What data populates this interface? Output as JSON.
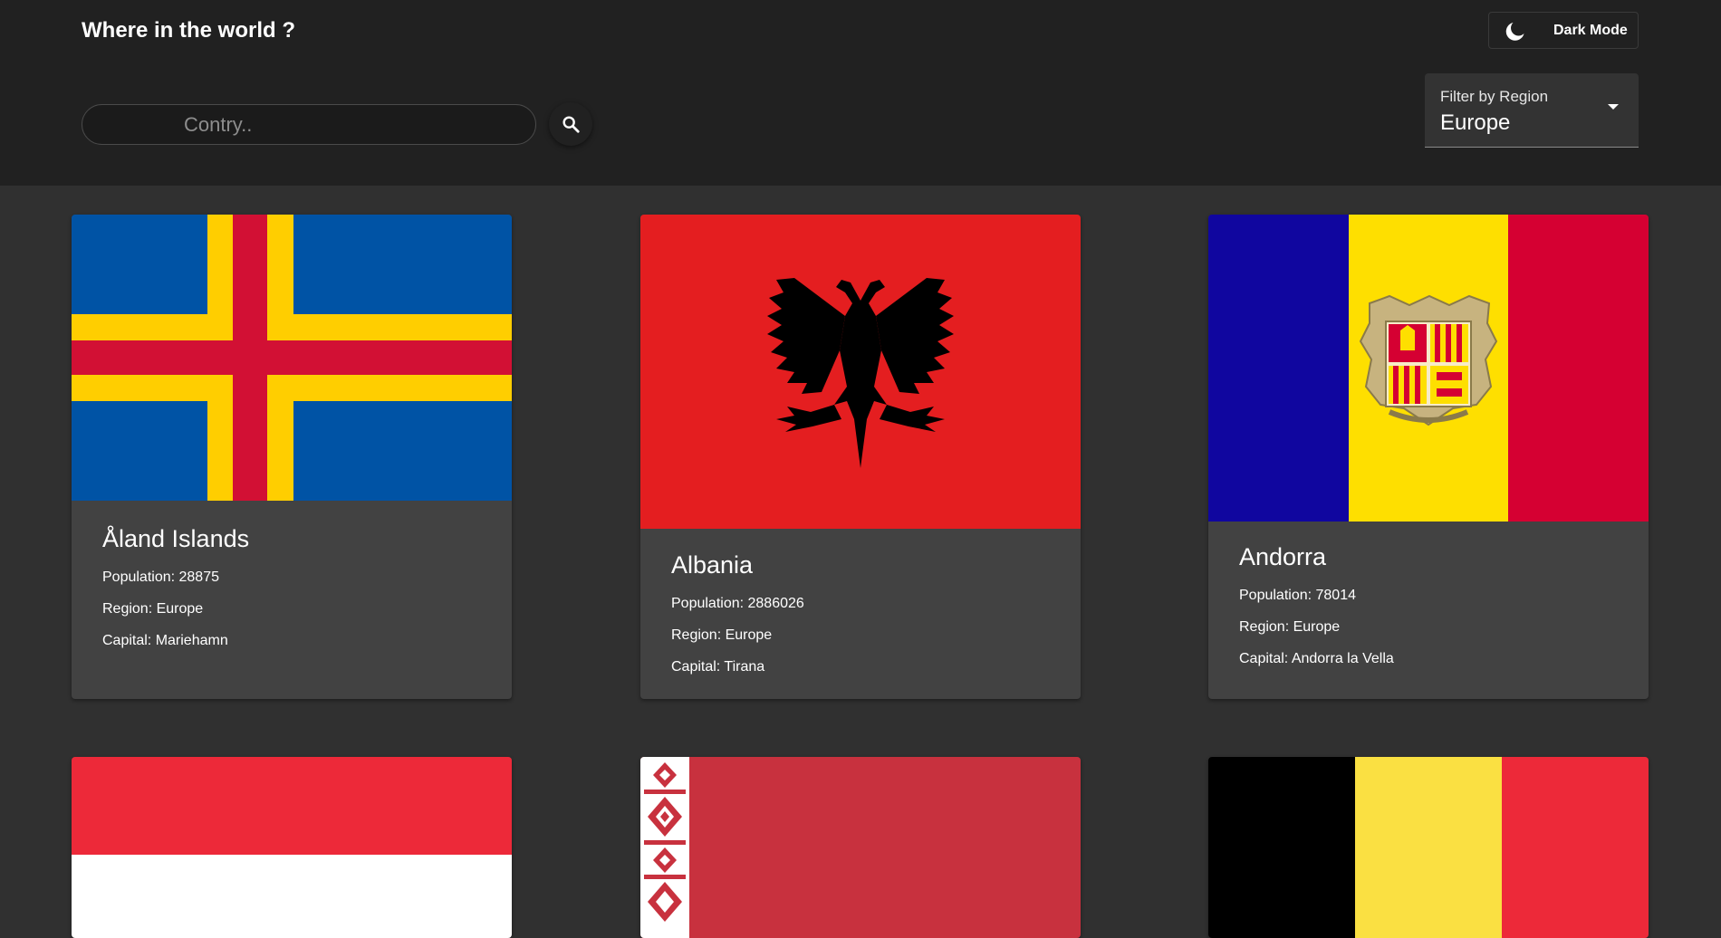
{
  "header": {
    "title": "Where in the world ?",
    "mode_label": "Dark Mode",
    "mode_icon": "moon-icon"
  },
  "search": {
    "placeholder": "Contry..",
    "value": "",
    "icon": "search-icon"
  },
  "filter": {
    "label": "Filter by Region",
    "value": "Europe"
  },
  "labels": {
    "population": "Population: ",
    "region": "Region: ",
    "capital": "Capital: "
  },
  "countries": [
    {
      "name": "Åland Islands",
      "population": "Population: 28875",
      "region": "Region: Europe",
      "capital": "Capital: Mariehamn",
      "flag": "aland-flag"
    },
    {
      "name": "Albania",
      "population": "Population: 2886026",
      "region": "Region: Europe",
      "capital": "Capital: Tirana",
      "flag": "albania-flag"
    },
    {
      "name": "Andorra",
      "population": "Population: 78014",
      "region": "Region: Europe",
      "capital": "Capital: Andorra la Vella",
      "flag": "andorra-flag"
    },
    {
      "flag": "austria-flag"
    },
    {
      "flag": "belarus-flag"
    },
    {
      "flag": "belgium-flag"
    }
  ],
  "colors": {
    "header_bg": "#212121",
    "page_bg": "#303030",
    "card_bg": "#424242",
    "text": "#ffffff"
  }
}
